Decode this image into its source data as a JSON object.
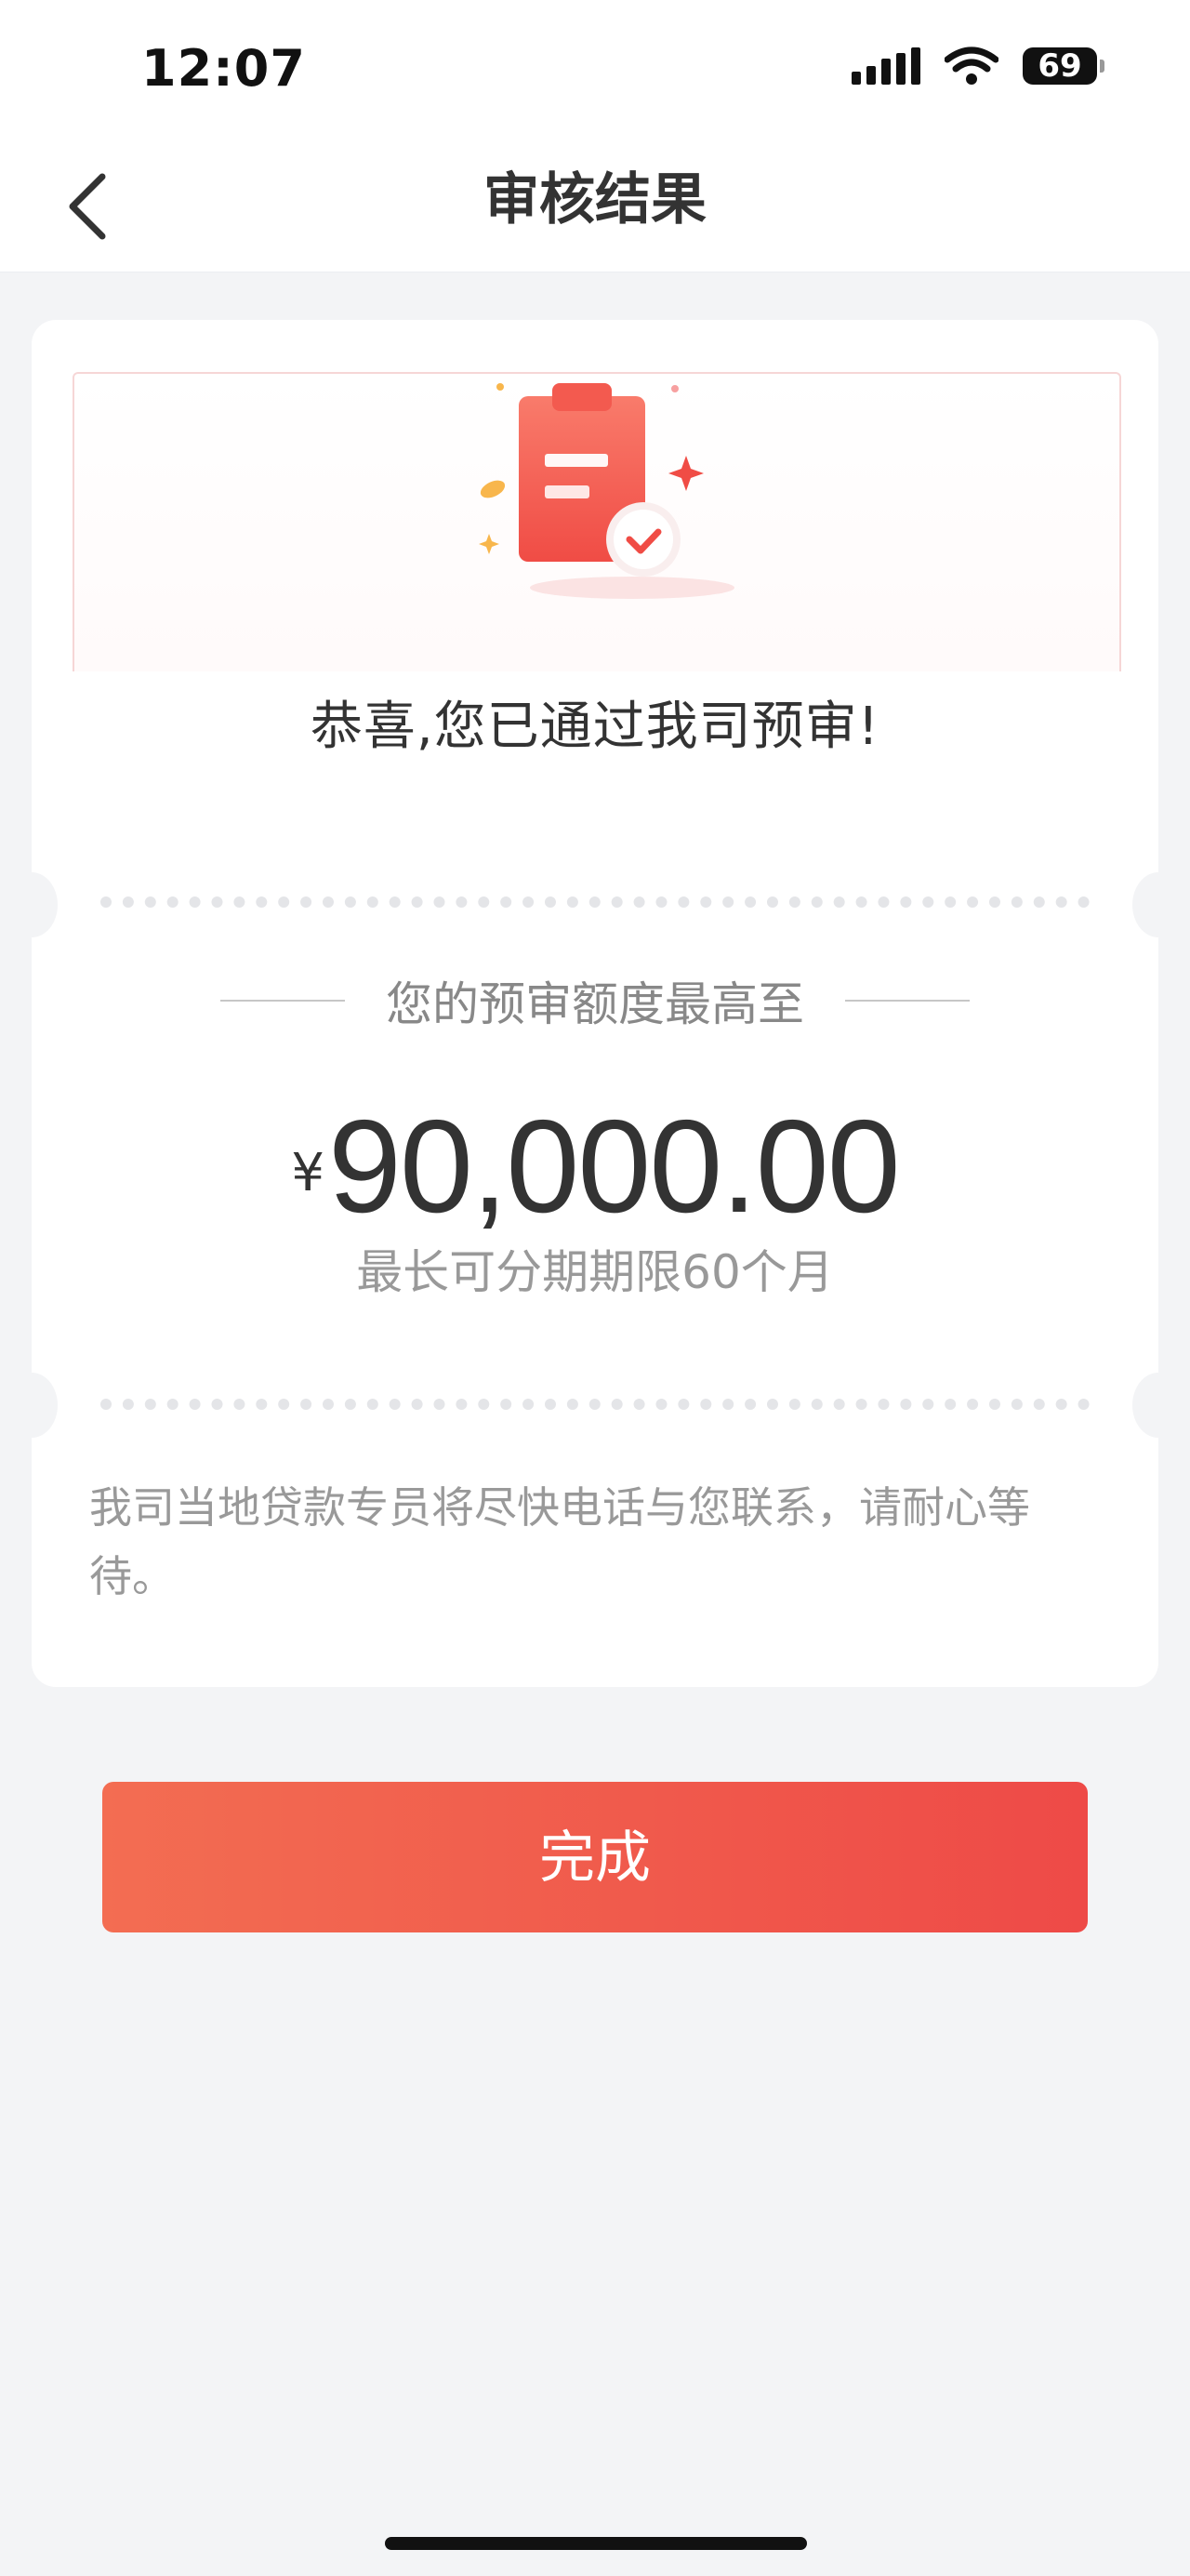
{
  "status_bar": {
    "time": "12:07",
    "battery": "69",
    "icons": [
      "signal-icon",
      "wifi-icon",
      "battery-icon"
    ]
  },
  "navbar": {
    "title": "审核结果",
    "back_icon": "chevron-left-icon"
  },
  "result": {
    "icon": "clipboard-check-icon",
    "title": "恭喜,您已通过我司预审!",
    "limit_caption": "您的预审额度最高至",
    "currency_symbol": "¥",
    "amount": "90,000.00",
    "term": "最长可分期期限60个月",
    "note": "我司当地贷款专员将尽快电话与您联系，请耐心等待。"
  },
  "actions": {
    "done_label": "完成"
  },
  "colors": {
    "accent_start": "#f36d52",
    "accent_end": "#ee4a47",
    "background": "#f3f4f6"
  }
}
